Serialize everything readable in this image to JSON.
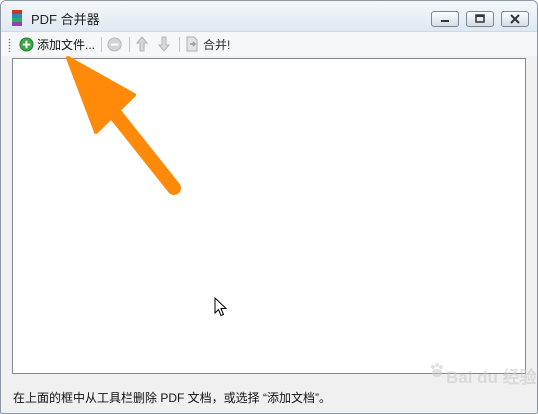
{
  "window": {
    "title": "PDF 合并器",
    "min_icon": "minimize-icon",
    "max_icon": "maximize-icon",
    "close_icon": "close-icon"
  },
  "toolbar": {
    "add_label": "添加文件...",
    "add_icon": "add-circle-icon",
    "remove_icon": "remove-circle-icon",
    "up_icon": "arrow-up-icon",
    "down_icon": "arrow-down-icon",
    "merge_label": "合并!",
    "merge_icon": "merge-document-icon"
  },
  "status": {
    "text": "在上面的框中从工具栏删除 PDF 文档，或选择 “添加文档”。"
  },
  "watermark": {
    "text": "Bai du 经验"
  },
  "colors": {
    "annotation_arrow": "#ff8a0a",
    "add_icon_green": "#2f9e3a",
    "titlebar": "#dfe8f1"
  }
}
